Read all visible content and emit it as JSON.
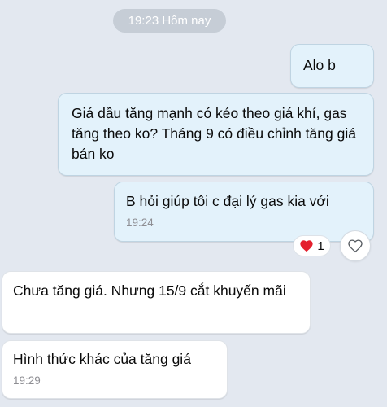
{
  "divider": {
    "label": "19:23 Hôm nay"
  },
  "messages": [
    {
      "text": "Alo b"
    },
    {
      "text": "Giá dầu tăng mạnh có kéo theo giá khí, gas tăng theo ko? Tháng 9 có điều chỉnh tăng giá bán ko"
    },
    {
      "text": "B hỏi giúp tôi c đại lý gas kia với",
      "time": "19:24"
    },
    {
      "text": "Chưa tăng giá. Nhưng 15/9 cắt khuyến mãi"
    },
    {
      "text": "Hình thức khác của tăng giá",
      "time": "19:29"
    }
  ],
  "reaction": {
    "icon": "heart-icon",
    "count": "1",
    "color": "#e4202e"
  },
  "react_button": {
    "icon": "heart-outline-icon"
  },
  "colors": {
    "background": "#e3e8f0",
    "sent_bubble": "#e3f2fb",
    "received_bubble": "#ffffff"
  }
}
